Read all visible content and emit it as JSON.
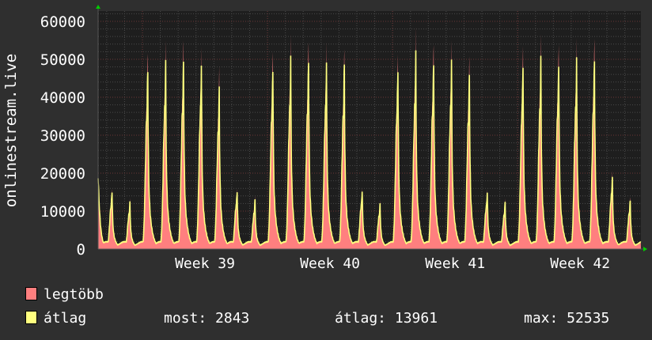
{
  "chart_data": {
    "type": "area",
    "ylabel": "onlinestream.live",
    "ylim": [
      0,
      62700
    ],
    "yticks": [
      0,
      10000,
      20000,
      30000,
      40000,
      50000,
      60000
    ],
    "xlim_days": [
      -2.48,
      27.9
    ],
    "xticks": [
      {
        "day": 3.5,
        "label": "Week 39"
      },
      {
        "day": 10.5,
        "label": "Week 40"
      },
      {
        "day": 17.5,
        "label": "Week 41"
      },
      {
        "day": 24.5,
        "label": "Week 42"
      }
    ],
    "week_starts_days": [
      0,
      7,
      14,
      21
    ],
    "start_value": 20000,
    "daily_peaks": {
      "days": [
        -2,
        -1,
        0,
        1,
        2,
        3,
        4,
        5,
        6,
        7,
        8,
        9,
        10,
        11,
        12,
        13,
        14,
        15,
        16,
        17,
        18,
        19,
        20,
        21,
        22,
        23,
        24,
        25,
        26,
        27
      ],
      "max": [
        16500,
        13000,
        53000,
        54000,
        55000,
        54000,
        47000,
        16500,
        13500,
        54000,
        55000,
        55500,
        54500,
        52000,
        16500,
        12500,
        53500,
        56500,
        55500,
        54000,
        51000,
        16000,
        13000,
        55500,
        54500,
        56000,
        54000,
        56500,
        20500,
        13500
      ],
      "avg": [
        16000,
        12500,
        49500,
        50500,
        51000,
        50500,
        43000,
        16000,
        13000,
        50000,
        51000,
        51500,
        50500,
        49500,
        16000,
        12000,
        50000,
        52000,
        51500,
        50500,
        47500,
        15500,
        12500,
        51000,
        50500,
        51500,
        50500,
        52000,
        19500,
        13000
      ]
    },
    "series": [
      {
        "name": "legtöbb",
        "color": "#ff7f7f"
      },
      {
        "name": "átlag",
        "color": "#ffff7f"
      }
    ]
  },
  "legend": {
    "items": [
      {
        "label": "legtöbb"
      },
      {
        "label": "átlag"
      }
    ],
    "most": "most: 2843",
    "atlag": "átlag: 13961",
    "max": "max: 52535"
  }
}
